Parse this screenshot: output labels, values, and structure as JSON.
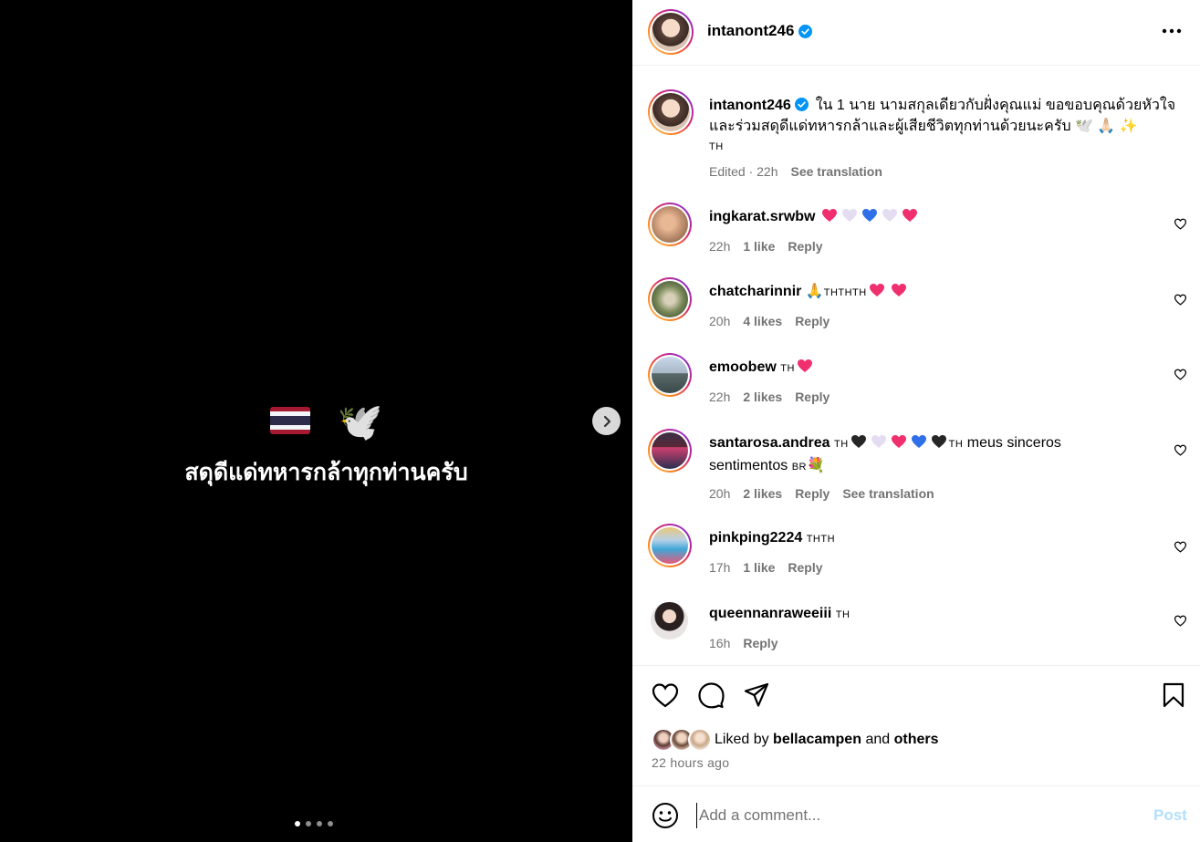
{
  "media": {
    "text": "สดุดีแด่ทหารกล้าทุกท่านครับ",
    "dove_emoji": "🕊️",
    "slide_count": 4,
    "active_slide": 1
  },
  "post": {
    "username": "intanont246",
    "verified": true,
    "caption": "ใน 1 นาย นามสกุลเดียวกับฝั่งคุณแม่ ขอขอบคุณด้วยหัวใจและร่วมสดุดีแด่ทหารกล้าและผู้เสียชีวิตทุกท่านด้วยนะครับ",
    "caption_emojis": "🕊️ 🙏🏻 ✨",
    "caption_tag": "TH",
    "edited_label": "Edited · 22h",
    "see_translation": "See translation"
  },
  "comments": [
    {
      "username": "ingkarat.srwbw",
      "time": "22h",
      "likes": "1 like",
      "reply": "Reply"
    },
    {
      "username": "chatcharinnir",
      "prefix": "🙏",
      "tag": "THTHTH",
      "time": "20h",
      "likes": "4 likes",
      "reply": "Reply"
    },
    {
      "username": "emoobew",
      "tag": "TH",
      "time": "22h",
      "likes": "2 likes",
      "reply": "Reply"
    },
    {
      "username": "santarosa.andrea",
      "tag1": "TH",
      "tag2": "TH",
      "text": "meus sinceros sentimentos",
      "tag3": "BR",
      "suffix": "💐",
      "time": "20h",
      "likes": "2 likes",
      "reply": "Reply",
      "see_translation": "See translation"
    },
    {
      "username": "pinkping2224",
      "tag": "THTH",
      "time": "17h",
      "likes": "1 like",
      "reply": "Reply"
    },
    {
      "username": "queennanraweeiii",
      "tag": "TH",
      "time": "16h",
      "reply": "Reply"
    }
  ],
  "likes": {
    "prefix": "Liked by",
    "user": "bellacampen",
    "and": "and",
    "others": "others"
  },
  "time_ago": "22 hours ago",
  "add_comment": {
    "placeholder": "Add a comment...",
    "post_label": "Post"
  },
  "colors": {
    "heart_pink": "#f0306e",
    "heart_blue": "#2f6fe8",
    "heart_black": "#262626",
    "heart_white": "#e4ddf2",
    "verified_blue": "#0095f6",
    "post_disabled": "#b2dffc"
  },
  "icons": [
    "verified-badge-icon",
    "more-options-icon",
    "chevron-right-icon",
    "heart-icon",
    "comment-icon",
    "share-icon",
    "bookmark-icon",
    "emoji-icon"
  ]
}
